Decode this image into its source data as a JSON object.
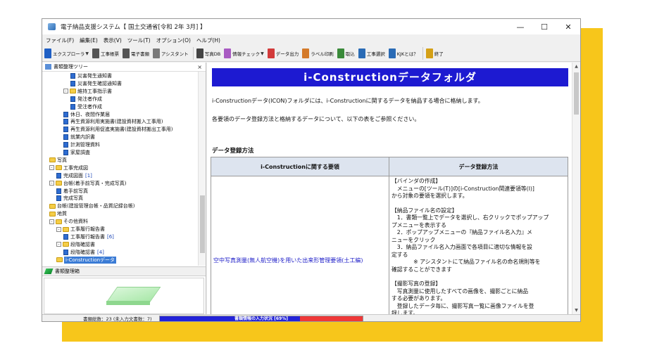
{
  "window": {
    "title": "電子納品支援システム【 国土交通省[令和 2年 3月] 】",
    "min": "—",
    "max": "☐",
    "close": "✕"
  },
  "menubar": [
    "ファイル(F)",
    "編集(E)",
    "表示(V)",
    "ツール(T)",
    "オプション(O)",
    "ヘルプ(H)"
  ],
  "toolbar": [
    {
      "label": "エクスプローラ",
      "icon": "explorer-icon",
      "color": "#1f5fc4",
      "dropdown": true
    },
    {
      "label": "工事帳票",
      "icon": "ledger-icon",
      "color": "#555555"
    },
    {
      "label": "電子書類",
      "icon": "e-document-icon",
      "color": "#555555"
    },
    {
      "label": "アシスタント",
      "icon": "assistant-icon",
      "color": "#7a7a7a"
    },
    {
      "label": "写真DB",
      "icon": "photo-db-icon",
      "color": "#444444"
    },
    {
      "label": "情報チェック",
      "icon": "info-check-icon",
      "color": "#a85ac2",
      "dropdown": true
    },
    {
      "label": "データ出力",
      "icon": "data-output-icon",
      "color": "#d23a3a"
    },
    {
      "label": "ラベル印刷",
      "icon": "label-print-icon",
      "color": "#d47a2a"
    },
    {
      "label": "取込",
      "icon": "import-icon",
      "color": "#3a8a3a"
    },
    {
      "label": "工事選択",
      "icon": "construction-select-icon",
      "color": "#2a6bb5"
    },
    {
      "label": "KJKとは？",
      "icon": "kjk-about-icon",
      "color": "#2a6bb5"
    },
    {
      "label": "終了",
      "icon": "exit-icon",
      "color": "#d4a017"
    }
  ],
  "left": {
    "tree_title": "書類整理ツリー",
    "close": "×",
    "tree": [
      {
        "label": "災害発生通知書",
        "type": "doc",
        "level": 3
      },
      {
        "label": "災害発生確認通知書",
        "type": "doc",
        "level": 3
      },
      {
        "label": "維持工事指示書",
        "type": "folder",
        "level": 2,
        "expander": "-"
      },
      {
        "label": "発注者作成",
        "type": "doc",
        "level": 3
      },
      {
        "label": "受注者作成",
        "type": "doc",
        "level": 3
      },
      {
        "label": "休日、夜間作業届",
        "type": "doc",
        "level": 2
      },
      {
        "label": "再生資源利用実施書(建設資材搬入工事用)",
        "type": "doc",
        "level": 2
      },
      {
        "label": "再生資源利用促進実施書(建設資材搬出工事用)",
        "type": "doc",
        "level": 2
      },
      {
        "label": "就業内訳書",
        "type": "doc",
        "level": 2
      },
      {
        "label": "計測管理資料",
        "type": "doc",
        "level": 2
      },
      {
        "label": "家屋調査",
        "type": "doc",
        "level": 2
      },
      {
        "label": "写真",
        "type": "folder",
        "level": 0
      },
      {
        "label": "工事完成図",
        "type": "folder",
        "level": 0,
        "expander": "-"
      },
      {
        "label": "完成図面",
        "type": "doc",
        "level": 1,
        "count": "[1]"
      },
      {
        "label": "台帳(着手前写真・完成写真)",
        "type": "folder",
        "level": 0,
        "expander": "-"
      },
      {
        "label": "着手前写真",
        "type": "doc",
        "level": 1
      },
      {
        "label": "完成写真",
        "type": "doc",
        "level": 1
      },
      {
        "label": "台帳(建設管理台帳・品質記録台帳)",
        "type": "folder",
        "level": 0
      },
      {
        "label": "地質",
        "type": "folder",
        "level": 0
      },
      {
        "label": "その他資料",
        "type": "folder",
        "level": 0,
        "expander": "-"
      },
      {
        "label": "工事履行報告書",
        "type": "folder",
        "level": 1,
        "expander": "-"
      },
      {
        "label": "工事履行報告書",
        "type": "doc",
        "level": 2,
        "count": "[6]"
      },
      {
        "label": "段階確認書",
        "type": "folder",
        "level": 1,
        "expander": "-"
      },
      {
        "label": "段階確認書",
        "type": "doc",
        "level": 2,
        "count": "[4]"
      },
      {
        "label": "i-Constructionデータ",
        "type": "folder",
        "level": 1,
        "selected": true
      }
    ],
    "organizer_title": "書類整理箱"
  },
  "main": {
    "banner": "i-Constructionデータフォルダ",
    "intro1": "i-Constructionデータ(ICON)フォルダには、i-Constructionに関するデータを納品する場合に格納します。",
    "intro2": "各要領のデータ登録方法と格納するデータについて、以下の表をご参照ください。",
    "section": "データ登録方法",
    "table": {
      "headers": [
        "i-Constructionに関する要領",
        "データ登録方法"
      ],
      "row": {
        "requirement": "空中写真測量(無人航空機)を用いた出来形管理要領(土工編)",
        "method": [
          "【バインダの作成】",
          "　メニューの[ツール(T)]の[i-Construction関連要領等(I)]",
          "から対象の要領を選択します。",
          "",
          "【納品ファイル名の設定】",
          "　1．書類一覧上でデータを選択し、右クリックでポップアップ",
          "プメニューを表示する",
          "　2．ポップアップメニューの『納品ファイル名入力』メ",
          "ニューをクリック",
          "　3．納品ファイル名入力画面で各項目に適切な情報を設",
          "定する",
          "　　　　※ アシスタントにて納品ファイル名の命名規則等を",
          "確認することができます",
          "",
          "【撮影写真の登録】",
          "　写真測量に使用したすべての画像を、撮影ごとに納品",
          "する必要があります。",
          "　登録したデータ毎に、撮影写真一覧に画像ファイルを登",
          "録します。"
        ]
      }
    }
  },
  "statusbar": {
    "counts": "書類総数：23 (未入力文書数：7)",
    "progress_label": "書類情報の入力状況 [69%]",
    "progress": 0.69
  },
  "colors": {
    "accent_yellow": "#f7c61b",
    "banner_blue": "#1d1ad1",
    "progress_blue": "#2323d8",
    "progress_red": "#ef3838"
  }
}
